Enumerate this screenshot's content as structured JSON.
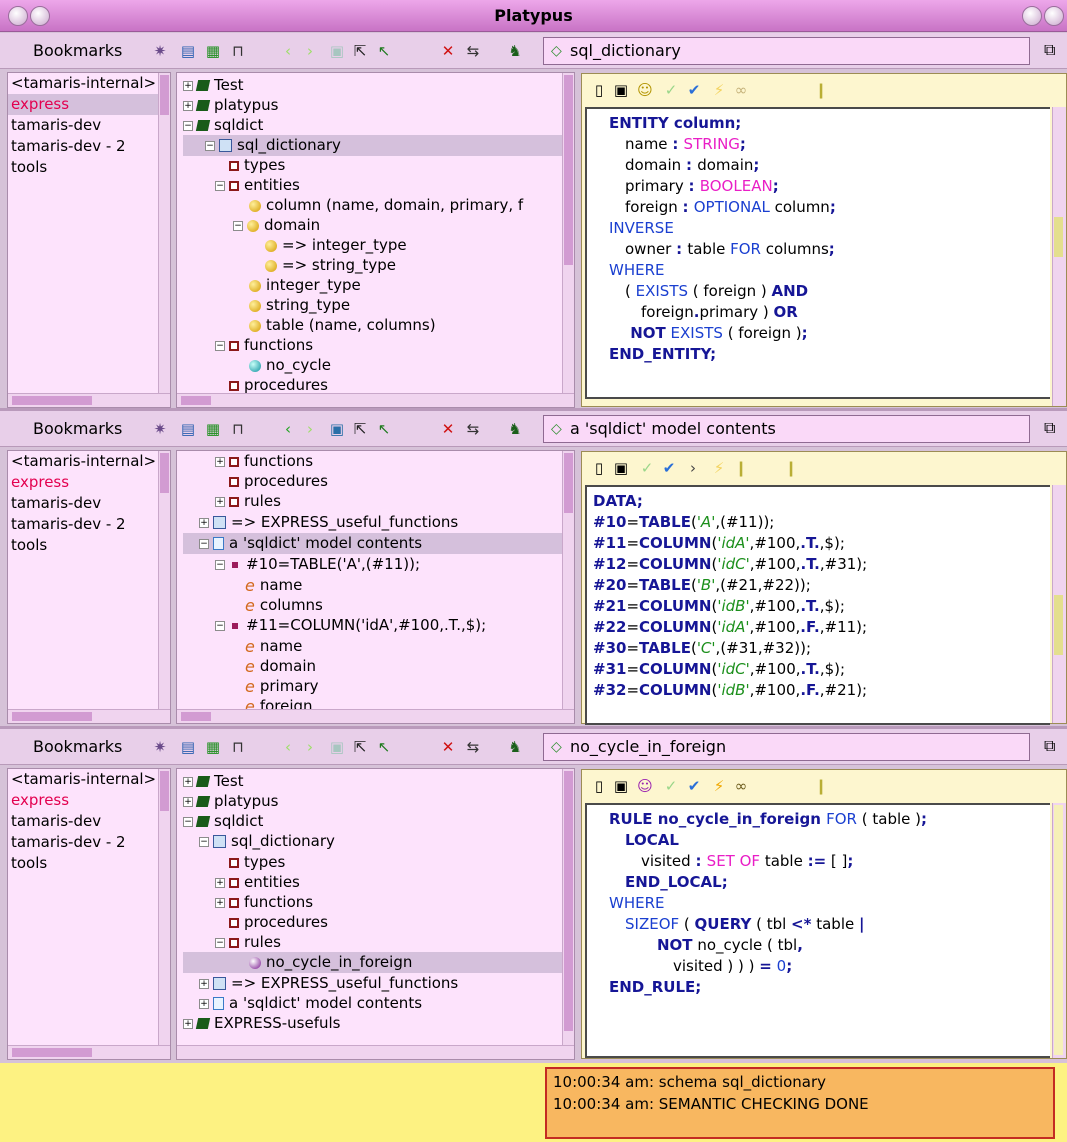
{
  "app": {
    "title": "Platypus"
  },
  "toolbar_icons": [
    "magic-wand-icon",
    "new-item-icon",
    "calendar-icon",
    "tree-icon",
    "back-icon",
    "forward-icon",
    "open-icon",
    "jump-icon",
    "up-icon",
    "close-icon",
    "refresh-icon",
    "run-icon"
  ],
  "colors": {
    "keyword": "#161696",
    "type": "#e91ec6",
    "operator": "#1a3fd0",
    "literal": "#1b8f1b"
  },
  "panes": [
    {
      "bookmarks_label": "Bookmarks",
      "address": "sql_dictionary",
      "bookmarks": [
        "<tamaris-internal>",
        "express",
        "tamaris-dev",
        "tamaris-dev - 2",
        "tools"
      ],
      "tree": [
        {
          "label": "Test"
        },
        {
          "label": "platypus"
        },
        {
          "label": "sqldict"
        },
        {
          "label": "sql_dictionary"
        },
        {
          "label": "types"
        },
        {
          "label": "entities"
        },
        {
          "label": "column (name, domain, primary, f"
        },
        {
          "label": "domain"
        },
        {
          "label": "=> integer_type"
        },
        {
          "label": "=> string_type"
        },
        {
          "label": "integer_type"
        },
        {
          "label": "string_type"
        },
        {
          "label": "table (name, columns)"
        },
        {
          "label": "functions"
        },
        {
          "label": "no_cycle"
        },
        {
          "label": "procedures"
        }
      ],
      "code": [
        {
          "indent": 1,
          "parts": [
            {
              "t": "ENTITY column",
              "c": "kw"
            },
            {
              "t": ";",
              "c": "kw"
            }
          ]
        },
        {
          "indent": 2,
          "parts": [
            {
              "t": "name ",
              "c": ""
            },
            {
              "t": ": ",
              "c": "kw"
            },
            {
              "t": "STRING",
              "c": "mg"
            },
            {
              "t": ";",
              "c": "kw"
            }
          ]
        },
        {
          "indent": 2,
          "parts": [
            {
              "t": "domain ",
              "c": ""
            },
            {
              "t": ": ",
              "c": "kw"
            },
            {
              "t": "domain",
              "c": ""
            },
            {
              "t": ";",
              "c": "kw"
            }
          ]
        },
        {
          "indent": 2,
          "parts": [
            {
              "t": "primary ",
              "c": ""
            },
            {
              "t": ": ",
              "c": "kw"
            },
            {
              "t": "BOOLEAN",
              "c": "mg"
            },
            {
              "t": ";",
              "c": "kw"
            }
          ]
        },
        {
          "indent": 2,
          "parts": [
            {
              "t": "foreign ",
              "c": ""
            },
            {
              "t": ": ",
              "c": "kw"
            },
            {
              "t": "OPTIONAL",
              "c": "bl"
            },
            {
              "t": " column",
              "c": ""
            },
            {
              "t": ";",
              "c": "kw"
            }
          ]
        },
        {
          "indent": 1,
          "parts": [
            {
              "t": "INVERSE",
              "c": "bl"
            }
          ]
        },
        {
          "indent": 2,
          "parts": [
            {
              "t": "owner ",
              "c": ""
            },
            {
              "t": ": ",
              "c": "kw"
            },
            {
              "t": "table ",
              "c": ""
            },
            {
              "t": "FOR",
              "c": "bl"
            },
            {
              "t": " columns",
              "c": ""
            },
            {
              "t": ";",
              "c": "kw"
            }
          ]
        },
        {
          "indent": 1,
          "parts": [
            {
              "t": "WHERE",
              "c": "bl"
            }
          ]
        },
        {
          "indent": 2,
          "parts": [
            {
              "t": "( ",
              "c": ""
            },
            {
              "t": "EXISTS",
              "c": "bl"
            },
            {
              "t": " ( foreign ) ",
              "c": ""
            },
            {
              "t": "AND",
              "c": "kw"
            }
          ]
        },
        {
          "indent": 3,
          "parts": [
            {
              "t": "foreign",
              "c": ""
            },
            {
              "t": ".",
              "c": "kw"
            },
            {
              "t": "primary ) ",
              "c": ""
            },
            {
              "t": "OR",
              "c": "kw"
            }
          ]
        },
        {
          "indent": 2,
          "parts": [
            {
              "t": " NOT",
              "c": "kw"
            },
            {
              "t": " EXISTS",
              "c": "bl"
            },
            {
              "t": " ( foreign )",
              "c": ""
            },
            {
              "t": ";",
              "c": "kw"
            }
          ]
        },
        {
          "indent": 1,
          "parts": [
            {
              "t": "END_ENTITY;",
              "c": "kw"
            }
          ]
        }
      ]
    },
    {
      "bookmarks_label": "Bookmarks",
      "address": "a 'sqldict' model contents",
      "bookmarks": [
        "<tamaris-internal>",
        "express",
        "tamaris-dev",
        "tamaris-dev - 2",
        "tools"
      ],
      "tree": [
        {
          "label": "functions"
        },
        {
          "label": "procedures"
        },
        {
          "label": "rules"
        },
        {
          "label": "=> EXPRESS_useful_functions"
        },
        {
          "label": "a 'sqldict' model contents"
        },
        {
          "label": "#10=TABLE('A',(#11));"
        },
        {
          "label": "name"
        },
        {
          "label": "columns"
        },
        {
          "label": "#11=COLUMN('idA',#100,.T.,$);"
        },
        {
          "label": "name"
        },
        {
          "label": "domain"
        },
        {
          "label": "primary"
        },
        {
          "label": "foreign"
        }
      ],
      "code": [
        {
          "indent": 0,
          "parts": [
            {
              "t": "DATA;",
              "c": "kw"
            }
          ]
        },
        {
          "indent": 0,
          "parts": [
            {
              "t": "#10",
              "c": "kw"
            },
            {
              "t": "=",
              "c": ""
            },
            {
              "t": "TABLE",
              "c": "kw"
            },
            {
              "t": "(",
              "c": ""
            },
            {
              "t": "'A'",
              "c": "gr"
            },
            {
              "t": ",(#11));",
              "c": ""
            }
          ]
        },
        {
          "indent": 0,
          "parts": [
            {
              "t": "#11",
              "c": "kw"
            },
            {
              "t": "=",
              "c": ""
            },
            {
              "t": "COLUMN",
              "c": "kw"
            },
            {
              "t": "(",
              "c": ""
            },
            {
              "t": "'idA'",
              "c": "gr"
            },
            {
              "t": ",#100,",
              "c": ""
            },
            {
              "t": ".T.",
              "c": "kw"
            },
            {
              "t": ",$);",
              "c": ""
            }
          ]
        },
        {
          "indent": 0,
          "parts": [
            {
              "t": "#12",
              "c": "kw"
            },
            {
              "t": "=",
              "c": ""
            },
            {
              "t": "COLUMN",
              "c": "kw"
            },
            {
              "t": "(",
              "c": ""
            },
            {
              "t": "'idC'",
              "c": "gr"
            },
            {
              "t": ",#100,",
              "c": ""
            },
            {
              "t": ".T.",
              "c": "kw"
            },
            {
              "t": ",#31);",
              "c": ""
            }
          ]
        },
        {
          "indent": 0,
          "parts": [
            {
              "t": "#20",
              "c": "kw"
            },
            {
              "t": "=",
              "c": ""
            },
            {
              "t": "TABLE",
              "c": "kw"
            },
            {
              "t": "(",
              "c": ""
            },
            {
              "t": "'B'",
              "c": "gr"
            },
            {
              "t": ",(#21,#22));",
              "c": ""
            }
          ]
        },
        {
          "indent": 0,
          "parts": [
            {
              "t": "#21",
              "c": "kw"
            },
            {
              "t": "=",
              "c": ""
            },
            {
              "t": "COLUMN",
              "c": "kw"
            },
            {
              "t": "(",
              "c": ""
            },
            {
              "t": "'idB'",
              "c": "gr"
            },
            {
              "t": ",#100,",
              "c": ""
            },
            {
              "t": ".T.",
              "c": "kw"
            },
            {
              "t": ",$);",
              "c": ""
            }
          ]
        },
        {
          "indent": 0,
          "parts": [
            {
              "t": "#22",
              "c": "kw"
            },
            {
              "t": "=",
              "c": ""
            },
            {
              "t": "COLUMN",
              "c": "kw"
            },
            {
              "t": "(",
              "c": ""
            },
            {
              "t": "'idA'",
              "c": "gr"
            },
            {
              "t": ",#100,",
              "c": ""
            },
            {
              "t": ".F.",
              "c": "kw"
            },
            {
              "t": ",#11);",
              "c": ""
            }
          ]
        },
        {
          "indent": 0,
          "parts": [
            {
              "t": "#30",
              "c": "kw"
            },
            {
              "t": "=",
              "c": ""
            },
            {
              "t": "TABLE",
              "c": "kw"
            },
            {
              "t": "(",
              "c": ""
            },
            {
              "t": "'C'",
              "c": "gr"
            },
            {
              "t": ",(#31,#32));",
              "c": ""
            }
          ]
        },
        {
          "indent": 0,
          "parts": [
            {
              "t": "#31",
              "c": "kw"
            },
            {
              "t": "=",
              "c": ""
            },
            {
              "t": "COLUMN",
              "c": "kw"
            },
            {
              "t": "(",
              "c": ""
            },
            {
              "t": "'idC'",
              "c": "gr"
            },
            {
              "t": ",#100,",
              "c": ""
            },
            {
              "t": ".T.",
              "c": "kw"
            },
            {
              "t": ",$);",
              "c": ""
            }
          ]
        },
        {
          "indent": 0,
          "parts": [
            {
              "t": "#32",
              "c": "kw"
            },
            {
              "t": "=",
              "c": ""
            },
            {
              "t": "COLUMN",
              "c": "kw"
            },
            {
              "t": "(",
              "c": ""
            },
            {
              "t": "'idB'",
              "c": "gr"
            },
            {
              "t": ",#100,",
              "c": ""
            },
            {
              "t": ".F.",
              "c": "kw"
            },
            {
              "t": ",#21);",
              "c": ""
            }
          ]
        }
      ]
    },
    {
      "bookmarks_label": "Bookmarks",
      "address": "no_cycle_in_foreign",
      "bookmarks": [
        "<tamaris-internal>",
        "express",
        "tamaris-dev",
        "tamaris-dev - 2",
        "tools"
      ],
      "tree": [
        {
          "label": "Test"
        },
        {
          "label": "platypus"
        },
        {
          "label": "sqldict"
        },
        {
          "label": "sql_dictionary"
        },
        {
          "label": "types"
        },
        {
          "label": "entities"
        },
        {
          "label": "functions"
        },
        {
          "label": "procedures"
        },
        {
          "label": "rules"
        },
        {
          "label": "no_cycle_in_foreign"
        },
        {
          "label": "=> EXPRESS_useful_functions"
        },
        {
          "label": "a 'sqldict' model contents"
        },
        {
          "label": "EXPRESS-usefuls"
        }
      ],
      "code": [
        {
          "indent": 1,
          "parts": [
            {
              "t": "RULE no_cycle_in_foreign ",
              "c": "kw"
            },
            {
              "t": "FOR",
              "c": "bl"
            },
            {
              "t": " ( table )",
              "c": ""
            },
            {
              "t": ";",
              "c": "kw"
            }
          ]
        },
        {
          "indent": 2,
          "parts": [
            {
              "t": "LOCAL",
              "c": "kw"
            }
          ]
        },
        {
          "indent": 3,
          "parts": [
            {
              "t": "visited ",
              "c": ""
            },
            {
              "t": ": ",
              "c": "kw"
            },
            {
              "t": "SET OF",
              "c": "mg"
            },
            {
              "t": " table ",
              "c": ""
            },
            {
              "t": ":=",
              "c": "kw"
            },
            {
              "t": " [ ]",
              "c": ""
            },
            {
              "t": ";",
              "c": "kw"
            }
          ]
        },
        {
          "indent": 2,
          "parts": [
            {
              "t": "END_LOCAL;",
              "c": "kw"
            }
          ]
        },
        {
          "indent": 1,
          "parts": [
            {
              "t": "WHERE",
              "c": "bl"
            }
          ]
        },
        {
          "indent": 2,
          "parts": [
            {
              "t": "SIZEOF",
              "c": "bl"
            },
            {
              "t": " ( ",
              "c": ""
            },
            {
              "t": "QUERY",
              "c": "kw"
            },
            {
              "t": " ( tbl ",
              "c": ""
            },
            {
              "t": "<*",
              "c": "kw"
            },
            {
              "t": " table ",
              "c": ""
            },
            {
              "t": "|",
              "c": "kw"
            }
          ]
        },
        {
          "indent": 4,
          "parts": [
            {
              "t": "NOT",
              "c": "kw"
            },
            {
              "t": " no_cycle ( tbl",
              "c": ""
            },
            {
              "t": ",",
              "c": "kw"
            }
          ]
        },
        {
          "indent": 5,
          "parts": [
            {
              "t": "visited ) ) ) ",
              "c": ""
            },
            {
              "t": "=",
              "c": "kw"
            },
            {
              "t": " 0",
              "c": "bl"
            },
            {
              "t": ";",
              "c": "kw"
            }
          ]
        },
        {
          "indent": 1,
          "parts": [
            {
              "t": "END_RULE;",
              "c": "kw"
            }
          ]
        }
      ]
    }
  ],
  "log": [
    "10:00:34 am: schema sql_dictionary",
    "10:00:34 am: SEMANTIC CHECKING DONE"
  ]
}
